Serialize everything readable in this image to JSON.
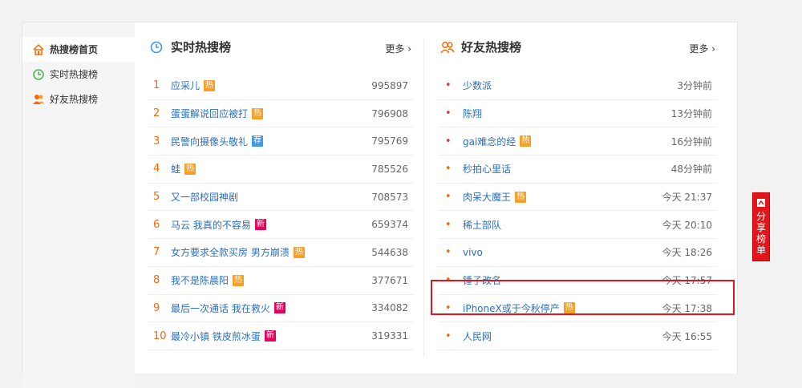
{
  "sidebar": {
    "items": [
      {
        "label": "热搜榜首页",
        "icon": "home-icon",
        "active": true
      },
      {
        "label": "实时热搜榜",
        "icon": "clock-icon",
        "active": false
      },
      {
        "label": "好友热搜榜",
        "icon": "friends-icon",
        "active": false
      }
    ]
  },
  "realtime": {
    "title": "实时热搜榜",
    "more": "更多 ›",
    "rows": [
      {
        "rank": "1",
        "text": "应采儿",
        "tag": "热",
        "count": "995897"
      },
      {
        "rank": "2",
        "text": "蛋蛋解说回应被打",
        "tag": "热",
        "count": "796908"
      },
      {
        "rank": "3",
        "text": "民警向摄像头敬礼",
        "tag": "荐",
        "count": "795769"
      },
      {
        "rank": "4",
        "text": "蛙",
        "tag": "热",
        "count": "785526"
      },
      {
        "rank": "5",
        "text": "又一部校园神剧",
        "tag": "",
        "count": "708573"
      },
      {
        "rank": "6",
        "text": "马云 我真的不容易",
        "tag": "新",
        "count": "659374"
      },
      {
        "rank": "7",
        "text": "女方要求全款买房 男方崩溃",
        "tag": "热",
        "count": "544638"
      },
      {
        "rank": "8",
        "text": "我不是陈晨阳",
        "tag": "热",
        "count": "377671"
      },
      {
        "rank": "9",
        "text": "最后一次通话 我在救火",
        "tag": "新",
        "count": "334082"
      },
      {
        "rank": "10",
        "text": "最冷小镇 铁皮煎冰蛋",
        "tag": "新",
        "count": "319331"
      }
    ]
  },
  "friends": {
    "title": "好友热搜榜",
    "more": "更多 ›",
    "rows": [
      {
        "dot": "•",
        "text": "少数派",
        "tag": "",
        "time": "3分钟前"
      },
      {
        "dot": "•",
        "text": "陈翔",
        "tag": "",
        "time": "13分钟前"
      },
      {
        "dot": "•",
        "text": "gai难念的经",
        "tag": "热",
        "time": "16分钟前"
      },
      {
        "dot": "•",
        "text": "秒拍心里话",
        "tag": "",
        "time": "48分钟前"
      },
      {
        "dot": "•",
        "text": "肉呆大魔王",
        "tag": "热",
        "time": "今天 21:37"
      },
      {
        "dot": "•",
        "text": "稀土部队",
        "tag": "",
        "time": "今天 20:10"
      },
      {
        "dot": "•",
        "text": "vivo",
        "tag": "",
        "time": "今天 18:26"
      },
      {
        "dot": "•",
        "text": "锤子改名",
        "tag": "",
        "time": "今天 17:57"
      },
      {
        "dot": "•",
        "text": "iPhoneX或于今秋停产",
        "tag": "热",
        "time": "今天 17:38"
      },
      {
        "dot": "•",
        "text": "人民网",
        "tag": "",
        "time": "今天 16:55"
      }
    ]
  },
  "share": {
    "label": "分享榜单"
  },
  "colors": {
    "accent": "#ff6600",
    "link": "#2a6fbd",
    "hot": "#f7a027",
    "new": "#e6005c",
    "rec": "#3e9ae8",
    "highlight": "#e5141a"
  }
}
